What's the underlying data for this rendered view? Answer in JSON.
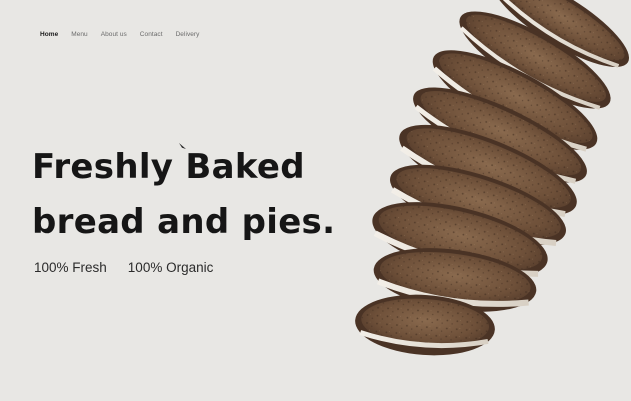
{
  "nav": {
    "items": [
      {
        "label": "Home",
        "active": true
      },
      {
        "label": "Menu",
        "active": false
      },
      {
        "label": "About us",
        "active": false
      },
      {
        "label": "Contact",
        "active": false
      },
      {
        "label": "Delivery",
        "active": false
      }
    ]
  },
  "hero": {
    "headline_line1": "Freshly Baked",
    "headline_line2": "bread and pies.",
    "tag1": "100% Fresh",
    "tag2": "100% Organic"
  },
  "colors": {
    "background": "#e8e7e4",
    "text": "#161616",
    "crust": "#4a3325",
    "crumb": "#7a5a40",
    "flour": "#e6e1d8"
  },
  "images": {
    "bread": "stack of sliced rye bread loaf"
  }
}
